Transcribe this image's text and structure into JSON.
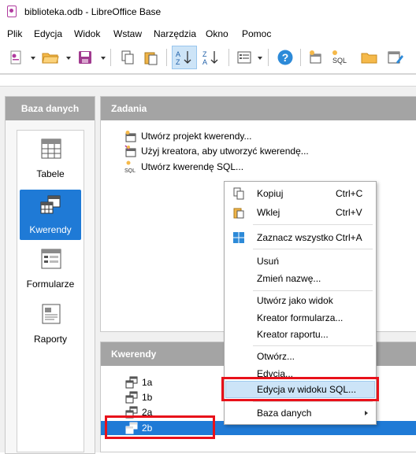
{
  "window": {
    "title": "biblioteka.odb - LibreOffice Base"
  },
  "menu": [
    "Plik",
    "Edycja",
    "Widok",
    "Wstaw",
    "Narzędzia",
    "Okno",
    "Pomoc"
  ],
  "left_panel": {
    "header": "Baza danych",
    "items": [
      "Tabele",
      "Kwerendy",
      "Formularze",
      "Raporty"
    ],
    "selected": "Kwerendy"
  },
  "tasks": {
    "header": "Zadania",
    "items": [
      "Utwórz projekt kwerendy...",
      "Użyj kreatora, aby utworzyć kwerendę...",
      "Utwórz kwerendę SQL..."
    ]
  },
  "queries": {
    "header": "Kwerendy",
    "items": [
      "1a",
      "1b",
      "2a",
      "2b"
    ],
    "selected": "2b"
  },
  "context_menu": {
    "items": [
      {
        "label": "Kopiuj",
        "shortcut": "Ctrl+C",
        "icon": "copy-icon"
      },
      {
        "label": "Wklej",
        "shortcut": "Ctrl+V",
        "icon": "paste-icon"
      },
      {
        "label": "Zaznacz wszystko",
        "shortcut": "Ctrl+A",
        "icon": "select-all-icon"
      },
      {
        "label": "Usuń"
      },
      {
        "label": "Zmień nazwę..."
      },
      {
        "label": "Utwórz jako widok"
      },
      {
        "label": "Kreator formularza..."
      },
      {
        "label": "Kreator raportu..."
      },
      {
        "label": "Otwórz..."
      },
      {
        "label": "Edycja..."
      },
      {
        "label": "Edycja w widoku SQL...",
        "highlighted": true
      },
      {
        "label": "Baza danych",
        "submenu": true
      }
    ]
  },
  "colors": {
    "accent": "#1f7ad6",
    "annotation": "#e8111a",
    "panel_header": "#a4a4a4"
  }
}
